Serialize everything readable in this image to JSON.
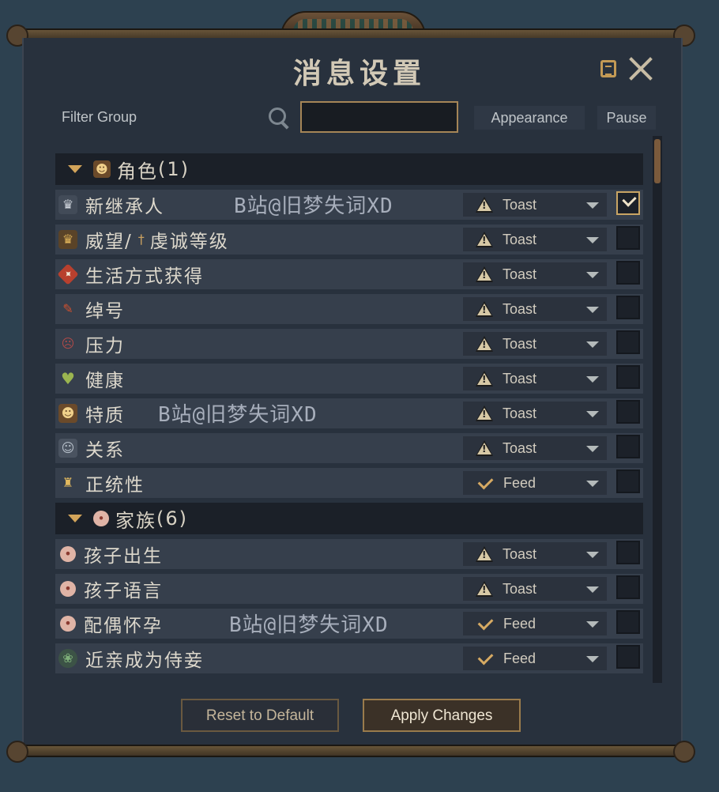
{
  "dialog": {
    "title": "消息设置"
  },
  "filter": {
    "label": "Filter Group",
    "search_value": ""
  },
  "columns": {
    "appearance": "Appearance",
    "pause": "Pause"
  },
  "groups": [
    {
      "title": "角色",
      "count": "(1)",
      "icon": "mask-icon"
    },
    {
      "title": "家族",
      "count": "(6)",
      "icon": "baby-icon"
    }
  ],
  "rows": [
    {
      "label": "新继承人",
      "appearance": "Toast",
      "appearance_icon": "warning-icon",
      "pause": true,
      "icon": "crown-icon",
      "watermark": "B站@旧梦失词XD"
    },
    {
      "label": "威望/",
      "label2": "虔诚等级",
      "appearance": "Toast",
      "appearance_icon": "warning-icon",
      "pause": false,
      "icon": "gold-crown-icon"
    },
    {
      "label": "生活方式获得",
      "appearance": "Toast",
      "appearance_icon": "warning-icon",
      "pause": false,
      "icon": "lifestyle-icon"
    },
    {
      "label": "绰号",
      "appearance": "Toast",
      "appearance_icon": "warning-icon",
      "pause": false,
      "icon": "quill-icon"
    },
    {
      "label": "压力",
      "appearance": "Toast",
      "appearance_icon": "warning-icon",
      "pause": false,
      "icon": "stress-head-icon"
    },
    {
      "label": "健康",
      "appearance": "Toast",
      "appearance_icon": "warning-icon",
      "pause": false,
      "icon": "heart-icon"
    },
    {
      "label": "特质",
      "appearance": "Toast",
      "appearance_icon": "warning-icon",
      "pause": false,
      "icon": "mask-icon",
      "watermark": "B站@旧梦失词XD"
    },
    {
      "label": "关系",
      "appearance": "Toast",
      "appearance_icon": "warning-icon",
      "pause": false,
      "icon": "relation-mask-icon"
    },
    {
      "label": "正统性",
      "appearance": "Feed",
      "appearance_icon": "check-icon",
      "pause": false,
      "icon": "legitimacy-icon"
    },
    {
      "label": "孩子出生",
      "appearance": "Toast",
      "appearance_icon": "warning-icon",
      "pause": false,
      "icon": "baby-icon"
    },
    {
      "label": "孩子语言",
      "appearance": "Toast",
      "appearance_icon": "warning-icon",
      "pause": false,
      "icon": "baby-icon"
    },
    {
      "label": "配偶怀孕",
      "appearance": "Feed",
      "appearance_icon": "check-icon",
      "pause": false,
      "icon": "baby-icon",
      "watermark": "B站@旧梦失词XD"
    },
    {
      "label": "近亲成为侍妾",
      "appearance": "Feed",
      "appearance_icon": "check-icon",
      "pause": false,
      "icon": "concubine-icon"
    }
  ],
  "buttons": {
    "reset": "Reset to Default",
    "apply": "Apply Changes"
  },
  "colors": {
    "accent": "#c9a564",
    "panel": "#28313d",
    "row": "#363f4c",
    "background": "#2d4150"
  }
}
